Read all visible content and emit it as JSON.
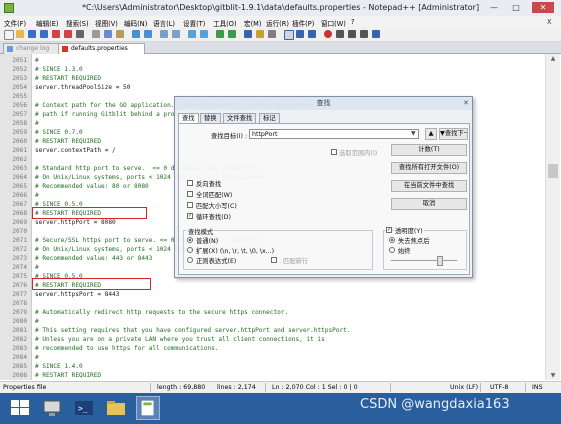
{
  "window": {
    "title": "*C:\\Users\\Administrator\\Desktop\\gitblit-1.9.1\\data\\defaults.properties - Notepad++ [Administrator]",
    "min": "—",
    "max": "□",
    "close": "✕"
  },
  "menu": {
    "items": [
      "文件(F)",
      "编辑(E)",
      "搜索(S)",
      "视图(V)",
      "编码(N)",
      "语言(L)",
      "设置(T)",
      "工具(O)",
      "宏(M)",
      "运行(R)",
      "插件(P)",
      "窗口(W)",
      "?"
    ],
    "close_x": "X"
  },
  "tabs": [
    {
      "label": "change log"
    },
    {
      "label": "defaults.properties"
    }
  ],
  "editor": {
    "lines": [
      {
        "n": "2051",
        "text": "#",
        "cls": "cm"
      },
      {
        "n": "2052",
        "text": "# SINCE 1.3.0",
        "cls": "cm"
      },
      {
        "n": "2053",
        "text": "# RESTART REQUIRED",
        "cls": "cm"
      },
      {
        "n": "2054",
        "text": "server.threadPoolSize = 50",
        "cls": "kv"
      },
      {
        "n": "2055",
        "text": "",
        "cls": "kv"
      },
      {
        "n": "2056",
        "text": "# Context path for the GO application.  You might want to change the context",
        "cls": "cm"
      },
      {
        "n": "2057",
        "text": "# path if running Gitblit behind a proxy layer such as mod_proxy.",
        "cls": "cm"
      },
      {
        "n": "2058",
        "text": "#",
        "cls": "cm"
      },
      {
        "n": "2059",
        "text": "# SINCE 0.7.0",
        "cls": "cm"
      },
      {
        "n": "2060",
        "text": "# RESTART REQUIRED",
        "cls": "cm"
      },
      {
        "n": "2061",
        "text": "server.contextPath = /",
        "cls": "kv"
      },
      {
        "n": "2062",
        "text": "",
        "cls": "kv"
      },
      {
        "n": "2063",
        "text": "# Standard http port to serve.  <= 0 disables this connector.",
        "cls": "cm"
      },
      {
        "n": "2064",
        "text": "# On Unix/Linux systems, ports < 1024 require root permissions.",
        "cls": "cm"
      },
      {
        "n": "2065",
        "text": "# Recommended value: 80 or 8080",
        "cls": "cm"
      },
      {
        "n": "2066",
        "text": "#",
        "cls": "cm"
      },
      {
        "n": "2067",
        "text": "# SINCE 0.5.0",
        "cls": "cm"
      },
      {
        "n": "2068",
        "text": "# RESTART REQUIRED",
        "cls": "cm"
      },
      {
        "n": "2069",
        "text": "server.httpPort = 8080",
        "cls": "kv"
      },
      {
        "n": "2070",
        "text": "",
        "cls": "kv"
      },
      {
        "n": "2071",
        "text": "# Secure/SSL https port to serve. <= 0 disables this connector.",
        "cls": "cm"
      },
      {
        "n": "2072",
        "text": "# On Unix/Linux systems, ports < 1024 require root permissions.",
        "cls": "cm"
      },
      {
        "n": "2073",
        "text": "# Recommended value: 443 or 8443",
        "cls": "cm"
      },
      {
        "n": "2074",
        "text": "#",
        "cls": "cm"
      },
      {
        "n": "2075",
        "text": "# SINCE 0.5.0",
        "cls": "cm"
      },
      {
        "n": "2076",
        "text": "# RESTART REQUIRED",
        "cls": "cm"
      },
      {
        "n": "2077",
        "text": "server.httpsPort = 8443",
        "cls": "kv"
      },
      {
        "n": "2078",
        "text": "",
        "cls": "kv"
      },
      {
        "n": "2079",
        "text": "# Automatically redirect http requests to the secure https connector.",
        "cls": "cm"
      },
      {
        "n": "2080",
        "text": "#",
        "cls": "cm"
      },
      {
        "n": "2081",
        "text": "# This setting requires that you have configured server.httpPort and server.httpsPort.",
        "cls": "cm"
      },
      {
        "n": "2082",
        "text": "# Unless you are on a private LAN where you trust all client connections, it is",
        "cls": "cm"
      },
      {
        "n": "2083",
        "text": "# recommended to use https for all communications.",
        "cls": "cm"
      },
      {
        "n": "2084",
        "text": "#",
        "cls": "cm"
      },
      {
        "n": "2085",
        "text": "# SINCE 1.4.0",
        "cls": "cm"
      },
      {
        "n": "2086",
        "text": "# RESTART REQUIRED",
        "cls": "cm"
      },
      {
        "n": "2087",
        "text": "server.redirectToHttpsPort = false",
        "cls": "kv"
      },
      {
        "n": "2088",
        "text": "",
        "cls": "kv"
      }
    ]
  },
  "find_dialog": {
    "title": "查找",
    "close": "✕",
    "tabs": [
      "查找",
      "替换",
      "文件查找",
      "标记"
    ],
    "find_what_label": "查找目标(I) :",
    "find_what_value": "httpPort",
    "in_selection": "选取范围内(I)",
    "btn_find_next": "▼查找下一个",
    "btn_up": "▲",
    "btn_count": "计数(T)",
    "btn_find_all_opened": "查找所有打开文件(O)",
    "btn_find_all_current": "在当前文件中查找",
    "btn_close": "取消",
    "opt_backward": "反向查找",
    "opt_whole_word": "全词匹配(W)",
    "opt_match_case": "匹配大小写(C)",
    "opt_wrap": "循环查找(D)",
    "search_mode_title": "查找模式",
    "mode_normal": "普通(N)",
    "mode_extended": "扩展(X) (\\n, \\r, \\t, \\0, \\x...)",
    "mode_regex": "正则表达式(E)",
    "dot_newline": ". 匹配新行",
    "transparency_title": "透明度(Y)",
    "trans_on_lose_focus": "失去焦点后",
    "trans_always": "始终"
  },
  "status": {
    "file_type": "Properties file",
    "length": "length : 69,880",
    "lines": "lines : 2,174",
    "pos": "Ln : 2,070    Col : 1    Sel : 0 | 0",
    "eol": "Unix (LF)",
    "encoding": "UTF-8",
    "ins": "INS"
  },
  "watermark": "CSDN @wangdaxia163"
}
